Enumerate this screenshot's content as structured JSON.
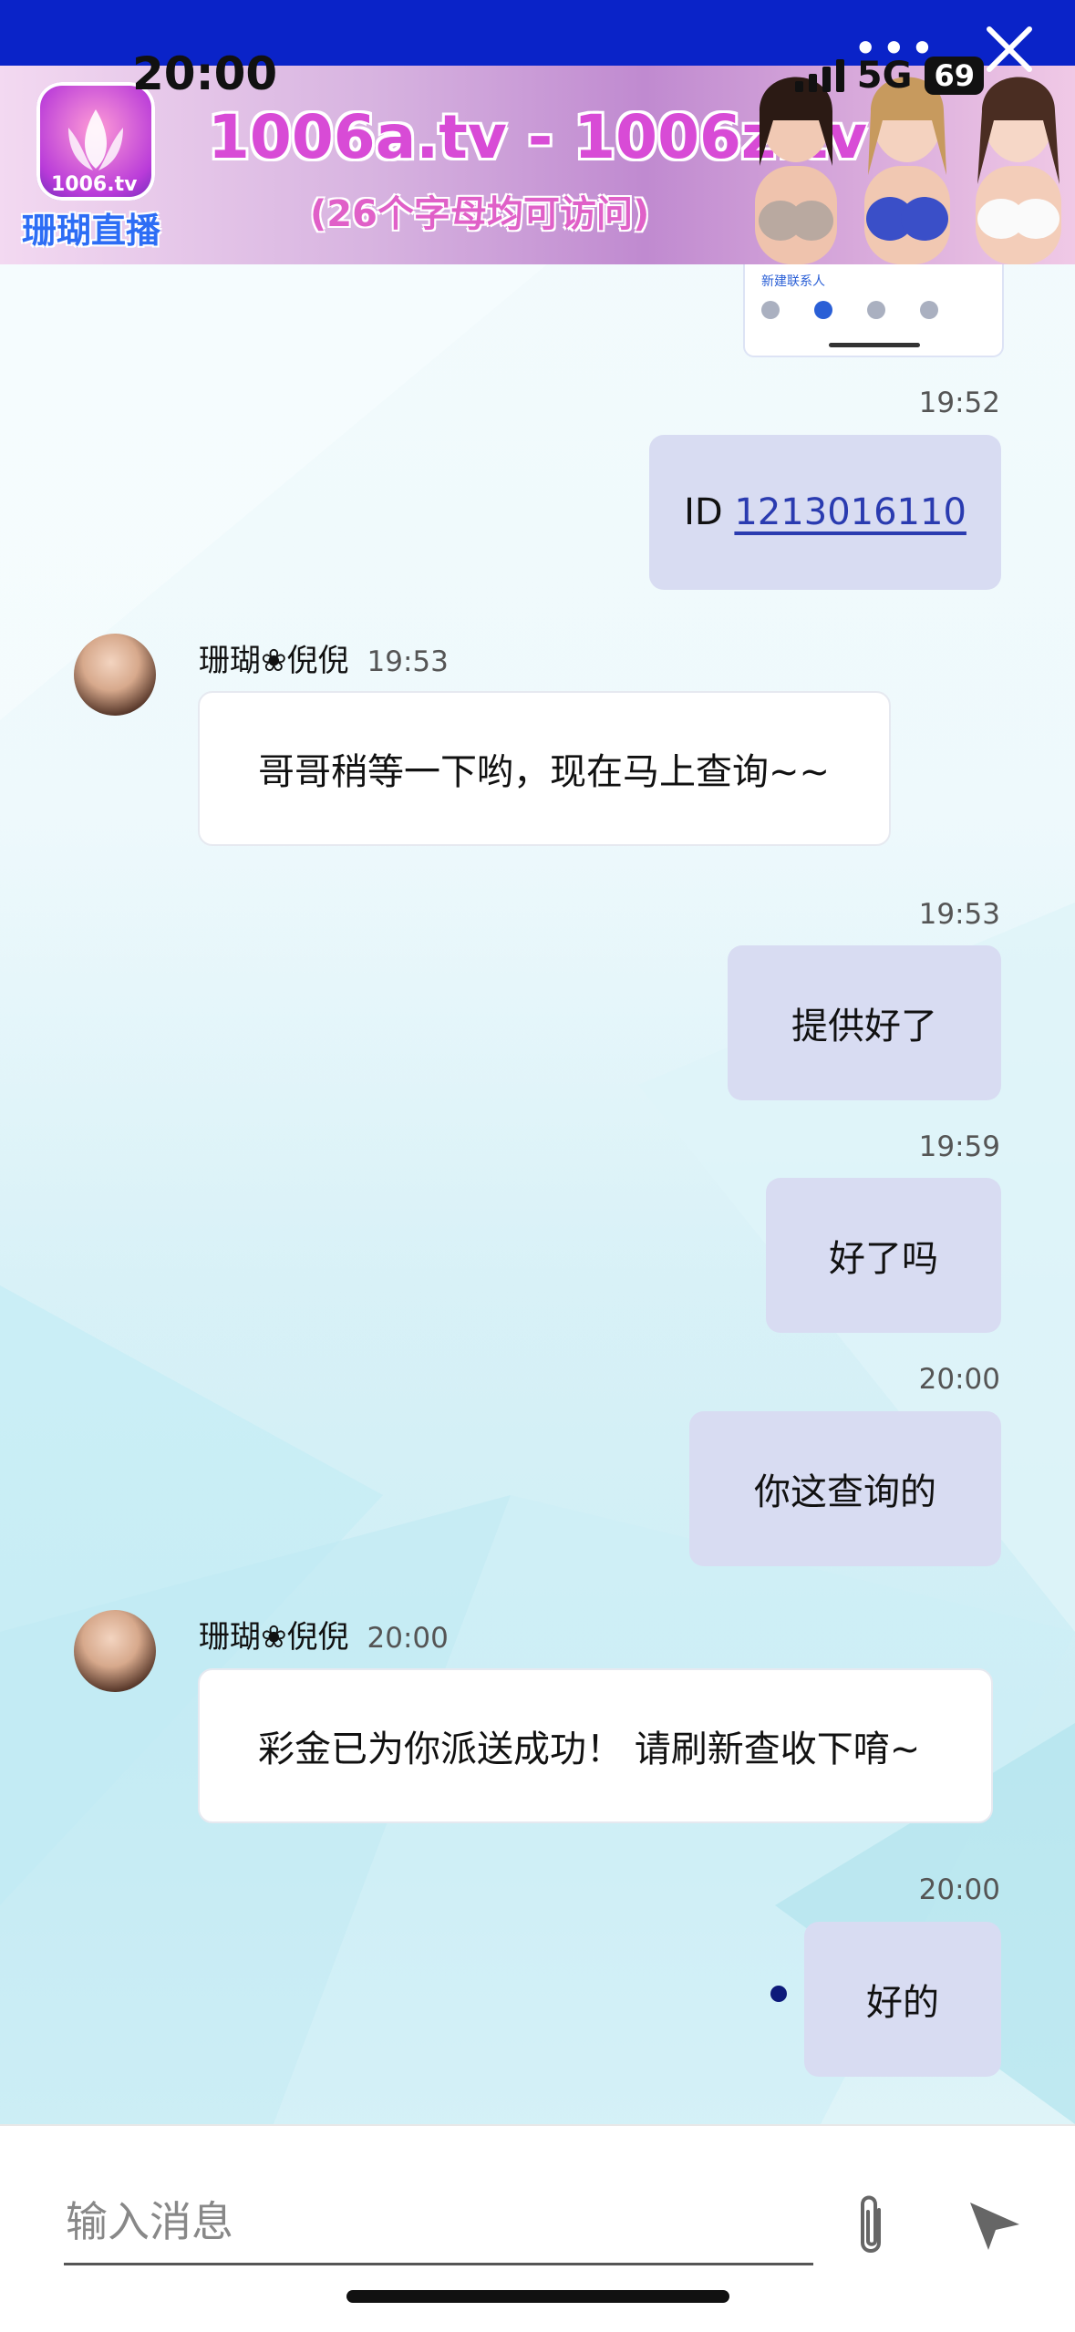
{
  "status_bar": {
    "time": "20:00",
    "network": "5G",
    "battery": "69"
  },
  "header": {
    "more_icon": "more-dots-icon",
    "close_icon": "close-icon"
  },
  "banner": {
    "logo_sub": "1006.tv",
    "logo_name": "珊瑚直播",
    "title": "1006a.tv - 1006z.tv",
    "subtitle": "(26个字母均可访问)"
  },
  "screenshot_preview": {
    "text": "新建联系人"
  },
  "messages": [
    {
      "type": "out",
      "time": "19:52",
      "prefix": "ID ",
      "link": "1213016110"
    },
    {
      "type": "in",
      "sender": "珊瑚❀倪倪",
      "time": "19:53",
      "text": "哥哥稍等一下哟，现在马上查询~~"
    },
    {
      "type": "out",
      "time": "19:53",
      "text": "提供好了"
    },
    {
      "type": "out",
      "time": "19:59",
      "text": "好了吗"
    },
    {
      "type": "out",
      "time": "20:00",
      "text": "你这查询的"
    },
    {
      "type": "in",
      "sender": "珊瑚❀倪倪",
      "time": "20:00",
      "text": "彩金已为你派送成功！ 请刷新查收下唷~"
    },
    {
      "type": "out",
      "time": "20:00",
      "text": "好的"
    }
  ],
  "composer": {
    "placeholder": "输入消息",
    "attach_icon": "paperclip-icon",
    "send_icon": "send-icon"
  },
  "colors": {
    "topbar": "#0a23c8",
    "bubble_out": "#d8dcf2",
    "link": "#2a3bb0"
  }
}
